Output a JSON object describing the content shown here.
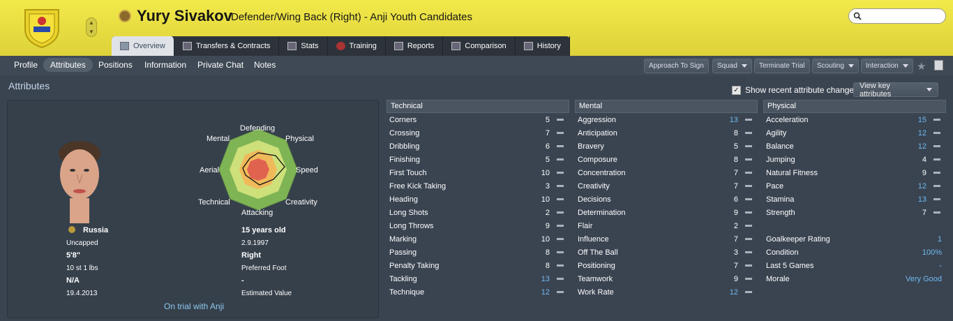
{
  "header": {
    "name": "Yury Sivakov",
    "role": "Defender/Wing Back (Right) - Anji Youth Candidates",
    "search_placeholder": ""
  },
  "tabs": [
    {
      "label": "Overview",
      "icon": "overview-icon"
    },
    {
      "label": "Transfers & Contracts",
      "icon": "contract-icon"
    },
    {
      "label": "Stats",
      "icon": "stats-icon"
    },
    {
      "label": "Training",
      "icon": "training-icon"
    },
    {
      "label": "Reports",
      "icon": "reports-icon"
    },
    {
      "label": "Comparison",
      "icon": "comparison-icon"
    },
    {
      "label": "History",
      "icon": "history-icon"
    }
  ],
  "subnav": [
    "Profile",
    "Attributes",
    "Positions",
    "Information",
    "Private Chat",
    "Notes"
  ],
  "actions": {
    "approach": "Approach To Sign",
    "squad": "Squad",
    "terminate": "Terminate Trial",
    "scouting": "Scouting",
    "interaction": "Interaction"
  },
  "section_title": "Attributes",
  "show_recent": "Show recent attribute changes",
  "view_key": "View key attributes",
  "radar": {
    "defending": "Defending",
    "physical": "Physical",
    "speed": "Speed",
    "creativity": "Creativity",
    "attacking": "Attacking",
    "technical": "Technical",
    "aerial": "Aerial",
    "mental": "Mental"
  },
  "profile": {
    "nation": "Russia",
    "caps": "Uncapped",
    "height": "5'8\"",
    "weight": "10 st 1 lbs",
    "value_left": "N/A",
    "date_left": "19.4.2013",
    "age": "15 years old",
    "dob": "2.9.1997",
    "foot": "Right",
    "foot_label": "Preferred Foot",
    "est_value": "-",
    "est_value_label": "Estimated Value",
    "trial": "On trial with Anji"
  },
  "technical": {
    "title": "Technical",
    "rows": [
      {
        "name": "Corners",
        "value": "5",
        "hi": false
      },
      {
        "name": "Crossing",
        "value": "7",
        "hi": false
      },
      {
        "name": "Dribbling",
        "value": "6",
        "hi": false
      },
      {
        "name": "Finishing",
        "value": "5",
        "hi": false
      },
      {
        "name": "First Touch",
        "value": "10",
        "hi": false
      },
      {
        "name": "Free Kick Taking",
        "value": "3",
        "hi": false
      },
      {
        "name": "Heading",
        "value": "10",
        "hi": false
      },
      {
        "name": "Long Shots",
        "value": "2",
        "hi": false
      },
      {
        "name": "Long Throws",
        "value": "9",
        "hi": false
      },
      {
        "name": "Marking",
        "value": "10",
        "hi": false
      },
      {
        "name": "Passing",
        "value": "8",
        "hi": false
      },
      {
        "name": "Penalty Taking",
        "value": "8",
        "hi": false
      },
      {
        "name": "Tackling",
        "value": "13",
        "hi": true
      },
      {
        "name": "Technique",
        "value": "12",
        "hi": true
      }
    ]
  },
  "mental": {
    "title": "Mental",
    "rows": [
      {
        "name": "Aggression",
        "value": "13",
        "hi": true
      },
      {
        "name": "Anticipation",
        "value": "8",
        "hi": false
      },
      {
        "name": "Bravery",
        "value": "5",
        "hi": false
      },
      {
        "name": "Composure",
        "value": "8",
        "hi": false
      },
      {
        "name": "Concentration",
        "value": "7",
        "hi": false
      },
      {
        "name": "Creativity",
        "value": "7",
        "hi": false
      },
      {
        "name": "Decisions",
        "value": "6",
        "hi": false
      },
      {
        "name": "Determination",
        "value": "9",
        "hi": false
      },
      {
        "name": "Flair",
        "value": "2",
        "hi": false
      },
      {
        "name": "Influence",
        "value": "7",
        "hi": false
      },
      {
        "name": "Off The Ball",
        "value": "3",
        "hi": false
      },
      {
        "name": "Positioning",
        "value": "7",
        "hi": false
      },
      {
        "name": "Teamwork",
        "value": "9",
        "hi": false
      },
      {
        "name": "Work Rate",
        "value": "12",
        "hi": true
      }
    ]
  },
  "physical": {
    "title": "Physical",
    "rows": [
      {
        "name": "Acceleration",
        "value": "15",
        "hi": true
      },
      {
        "name": "Agility",
        "value": "12",
        "hi": true
      },
      {
        "name": "Balance",
        "value": "12",
        "hi": true
      },
      {
        "name": "Jumping",
        "value": "4",
        "hi": false
      },
      {
        "name": "Natural Fitness",
        "value": "9",
        "hi": false
      },
      {
        "name": "Pace",
        "value": "12",
        "hi": true
      },
      {
        "name": "Stamina",
        "value": "13",
        "hi": true
      },
      {
        "name": "Strength",
        "value": "7",
        "hi": false
      }
    ],
    "extra": [
      {
        "name": "Goalkeeper Rating",
        "value": "1"
      },
      {
        "name": "Condition",
        "value": "100%"
      },
      {
        "name": "Last 5 Games",
        "value": "-"
      },
      {
        "name": "Morale",
        "value": "Very Good"
      }
    ]
  },
  "colors": {
    "highlight": "#6fb9f0",
    "header": "#efe545"
  }
}
